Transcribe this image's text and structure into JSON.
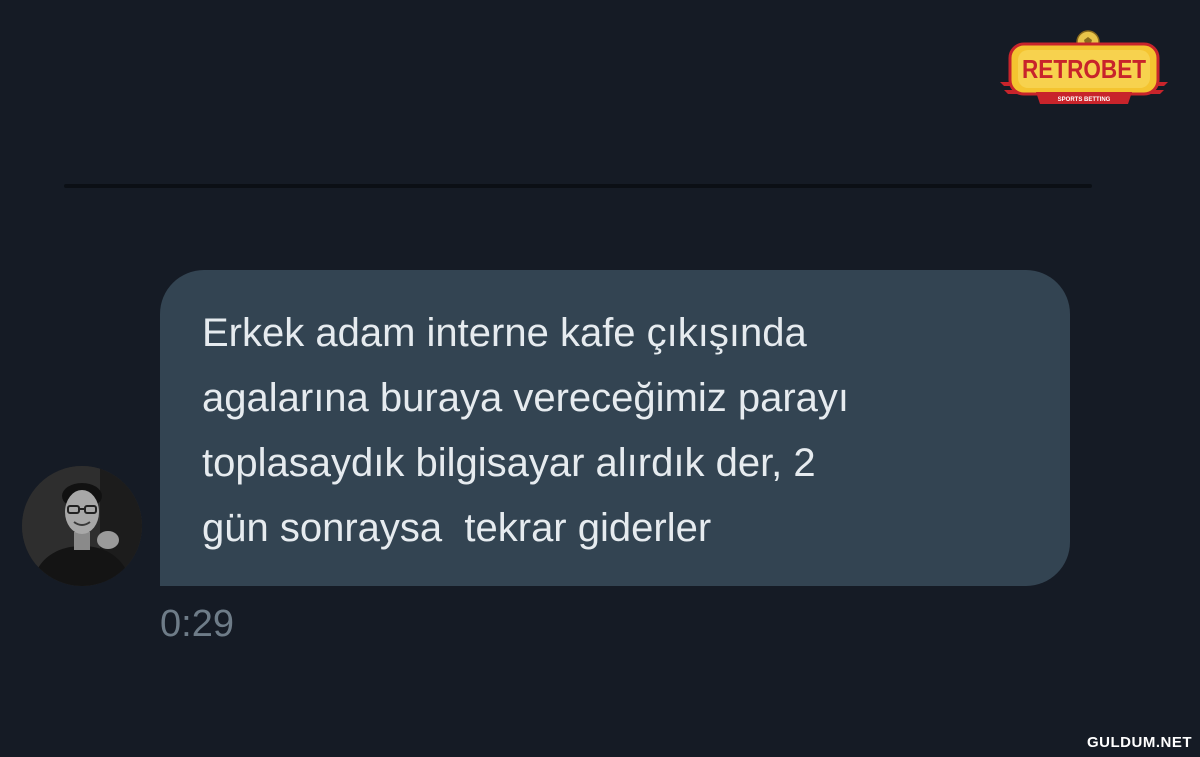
{
  "brand": {
    "name": "RETROBET",
    "tagline": "SPORTS BETTING"
  },
  "message": {
    "lines": [
      "Erkek adam interne kafe çıkışında",
      "agalarına buraya vereceğimiz parayı",
      "toplasaydık bilgisayar alırdık der, 2",
      "gün sonraysa  tekrar giderler"
    ],
    "timestamp": "0:29"
  },
  "watermark": "GULDUM.NET",
  "colors": {
    "background": "#151b25",
    "bubble": "#334452",
    "message_text": "#e6ebef",
    "timestamp_text": "#6e7c88",
    "brand_red": "#c8242b",
    "brand_yellow": "#f4c430"
  }
}
